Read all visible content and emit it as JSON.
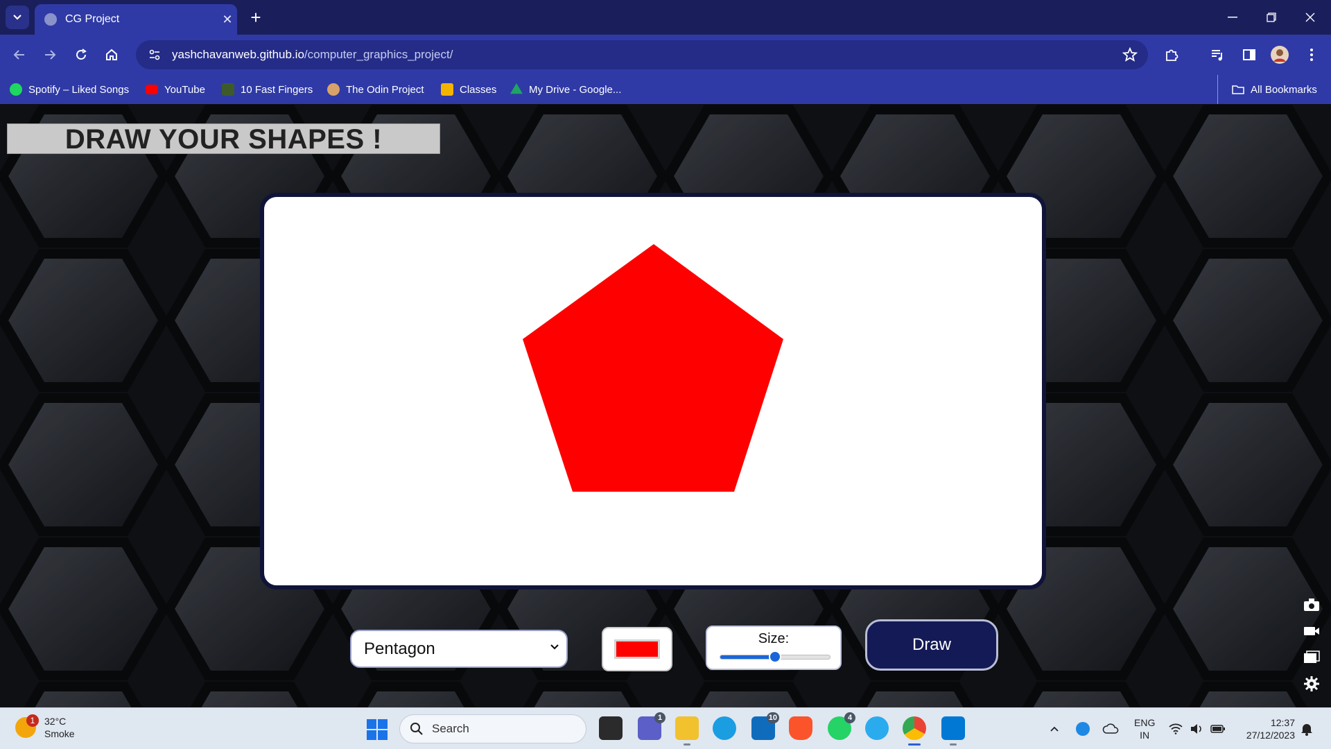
{
  "browser": {
    "tab_title": "CG Project",
    "url_domain": "yashchavanweb.github.io",
    "url_path": "/computer_graphics_project/",
    "bookmarks": [
      {
        "label": "Spotify – Liked Songs",
        "icon": "spotify-icon",
        "color": "#1ed760"
      },
      {
        "label": "YouTube",
        "icon": "youtube-icon",
        "color": "#ff0000"
      },
      {
        "label": "10 Fast Fingers",
        "icon": "10-fast-fingers-icon",
        "color": "#3f5a2a"
      },
      {
        "label": "The Odin Project",
        "icon": "odin-project-icon",
        "color": "#d8a36a"
      },
      {
        "label": "Classes",
        "icon": "classes-icon",
        "color": "#f3b400"
      },
      {
        "label": "My Drive - Google...",
        "icon": "google-drive-icon",
        "color": "#1fa463"
      }
    ],
    "all_bookmarks": "All Bookmarks"
  },
  "page": {
    "heading": "DRAW YOUR SHAPES !",
    "shape_select_value": "Pentagon",
    "color_value": "#ff0000",
    "size_label": "Size:",
    "size_slider_fraction": 0.5,
    "draw_button": "Draw",
    "shape_drawn": "pentagon"
  },
  "taskbar": {
    "weather_temp": "32°C",
    "weather_desc": "Smoke",
    "weather_badge": "1",
    "search_placeholder": "Search",
    "teams_badge": "1",
    "mail_badge": "10",
    "whatsapp_badge": "4",
    "lang_line1": "ENG",
    "lang_line2": "IN",
    "time": "12:37",
    "date": "27/12/2023"
  }
}
